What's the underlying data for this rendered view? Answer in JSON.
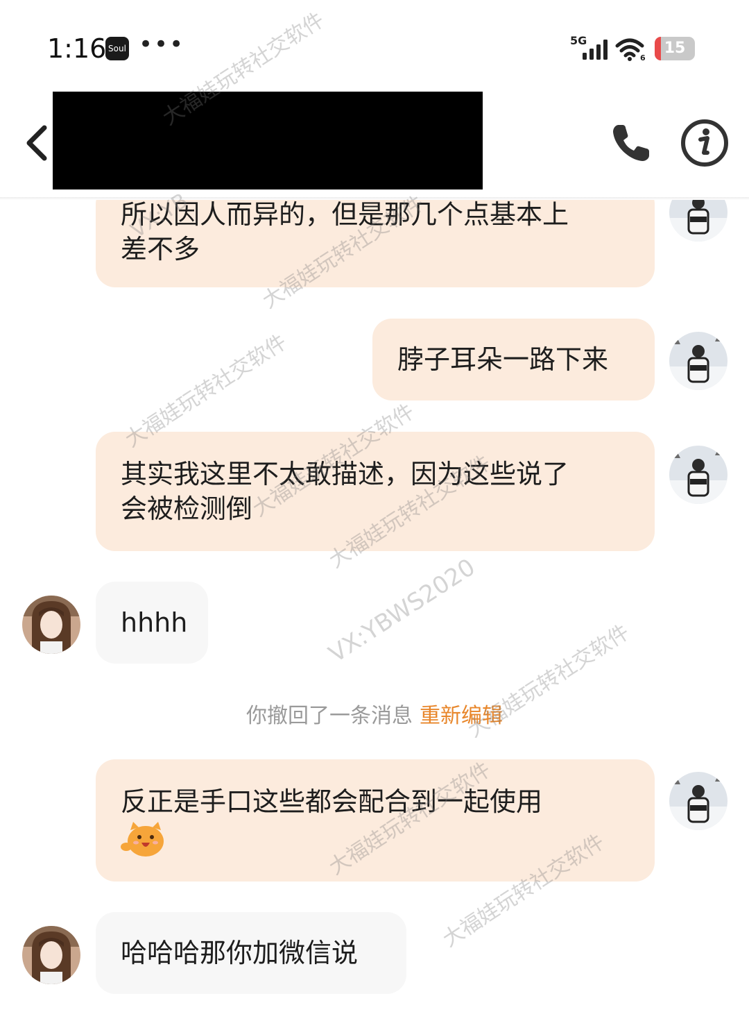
{
  "status_bar": {
    "time": "1:16",
    "app_badge": "Soul",
    "more_dots": "•••",
    "network": "5G",
    "battery_level": 15,
    "battery_text": "15"
  },
  "header": {
    "back_icon": "chevron-left-icon",
    "call_icon": "phone-icon",
    "info_icon": "info-circle-icon"
  },
  "messages": [
    {
      "side": "me",
      "text_lines": [
        "所以因人而异的，但是那几个点基本上",
        "差不多"
      ]
    },
    {
      "side": "me",
      "text_lines": [
        "脖子耳朵一路下来"
      ]
    },
    {
      "side": "me",
      "text_lines": [
        "其实我这里不太敢描述，因为这些说了",
        "会被检测倒"
      ]
    },
    {
      "side": "them",
      "text_lines": [
        "hhhh"
      ]
    },
    {
      "side": "me",
      "text_lines": [
        "反正是手口这些都会配合到一起使用"
      ],
      "emoji": "cheeky-face-emoji"
    },
    {
      "side": "them",
      "text_lines": [
        "哈哈哈那你加微信说"
      ]
    }
  ],
  "recall_notice": {
    "text": "你撤回了一条消息",
    "action": "重新编辑"
  },
  "watermarks": {
    "brand": "大福娃玩转社交软件",
    "vx": "VX:YBWS2020",
    "partial_vx": "VX:YB"
  },
  "colors": {
    "my_bubble": "#fcebdd",
    "their_bubble": "#f7f7f7",
    "reedit_accent": "#e8862a",
    "battery_low": "#e94a4a"
  }
}
